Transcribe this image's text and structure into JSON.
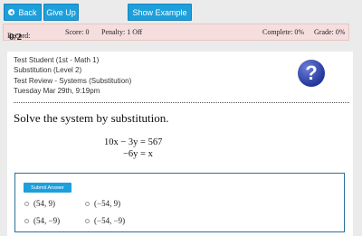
{
  "toolbar": {
    "back_label": "Back",
    "giveup_label": "Give Up",
    "example_label": "Show Example"
  },
  "status": {
    "record_label": "Record:",
    "record_value": "0/2",
    "score": "Score: 0",
    "penalty": "Penalty: 1 Off",
    "complete": "Complete: 0%",
    "grade": "Grade: 0%"
  },
  "header": {
    "student": "Test Student (1st - Math 1)",
    "topic": "Substitution (Level 2)",
    "assignment": "Test Review - Systems (Substitution)",
    "date": "Tuesday Mar 29th, 9:19pm"
  },
  "problem": {
    "prompt": "Solve the system by substitution.",
    "eq1": "10x − 3y = 567",
    "eq2": "−6y = x"
  },
  "answer": {
    "submit_label": "Submit Answer",
    "choices": [
      "(54, 9)",
      "(−54, 9)",
      "(54, −9)",
      "(−54, −9)"
    ]
  }
}
